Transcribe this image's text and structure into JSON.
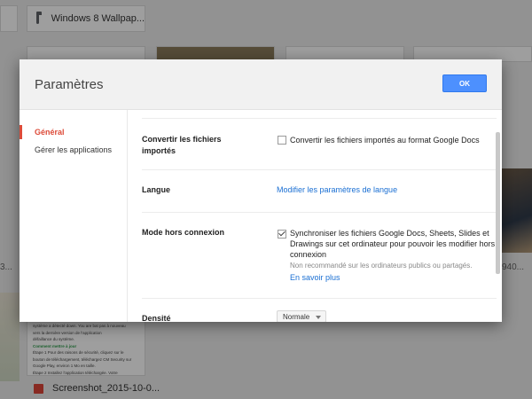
{
  "background": {
    "folder_name": "Windows 8 Wallpap...",
    "right_photo_label": "940...",
    "left_label": "3...",
    "doc_lines": [
      "système a détecté down. You are bat pas à nouveau",
      "vers la dernière version de l'application",
      "défaillance du système.",
      "Comment mettre à jour",
      "Étape 1 Pour des raisons de sécurité, cliquez sur le",
      "bouton de téléchargement, téléchargez CM Security sur",
      "Google Play, environ 1 Mo en taille.",
      "Étape 2 Installez l'application téléchargée. Votre"
    ],
    "file_name": "Screenshot_2015-10-0..."
  },
  "modal": {
    "title": "Paramètres",
    "ok_label": "OK",
    "sidebar": [
      {
        "label": "Général",
        "active": true
      },
      {
        "label": "Gérer les applications",
        "active": false
      }
    ],
    "rows": {
      "convert": {
        "label": "Convertir les fichiers importés",
        "checkbox_label": "Convertir les fichiers importés au format Google Docs",
        "checked": false
      },
      "language": {
        "label": "Langue",
        "link": "Modifier les paramètres de langue"
      },
      "offline": {
        "label": "Mode hors connexion",
        "checkbox_label": "Synchroniser les fichiers Google Docs, Sheets, Slides et Drawings sur cet ordinateur pour pouvoir les modifier hors connexion",
        "checked": true,
        "note": "Non recommandé sur les ordinateurs publics ou partagés.",
        "link": "En savoir plus"
      },
      "density": {
        "label": "Densité",
        "value": "Normale"
      }
    }
  },
  "colors": {
    "accent_red": "#dd4b39",
    "ok_blue": "#4d90fe",
    "link_blue": "#1a6fd3"
  }
}
